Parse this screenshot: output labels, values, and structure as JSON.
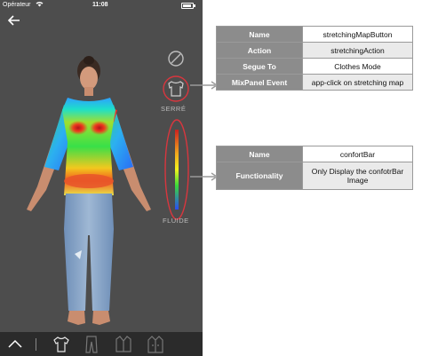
{
  "status_bar": {
    "carrier": "Opérateur",
    "time": "11:08"
  },
  "icons": {
    "back": "arrow-left-icon",
    "no_entry": "no-entry-icon",
    "stretching_map": "tshirt-icon",
    "comfort_bar": "gradient-bar-icon"
  },
  "fit_labels": {
    "tight": "SERRÉ",
    "loose": "FLUIDE"
  },
  "tabbar": {
    "items": [
      "chevron-up-icon",
      "tshirt-tab-icon",
      "pants-tab-icon",
      "jacket-tab-icon",
      "coat-tab-icon"
    ]
  },
  "callout_1": {
    "rows": [
      {
        "key": "Name",
        "value": "stretchingMapButton"
      },
      {
        "key": "Action",
        "value": "stretchingAction"
      },
      {
        "key": "Segue To",
        "value": "Clothes Mode"
      },
      {
        "key": "MixPanel  Event",
        "value": "app-click on stretching map"
      }
    ]
  },
  "callout_2": {
    "rows": [
      {
        "key": "Name",
        "value": "confortBar"
      },
      {
        "key": "Functionality",
        "value": "Only Display the confotrBar Image"
      }
    ]
  },
  "colors": {
    "phone_bg": "#4d4d4d",
    "highlight_ring": "#d9363e",
    "header_cell": "#8c8c8c",
    "tabbar_bg": "#2b2b2b"
  }
}
